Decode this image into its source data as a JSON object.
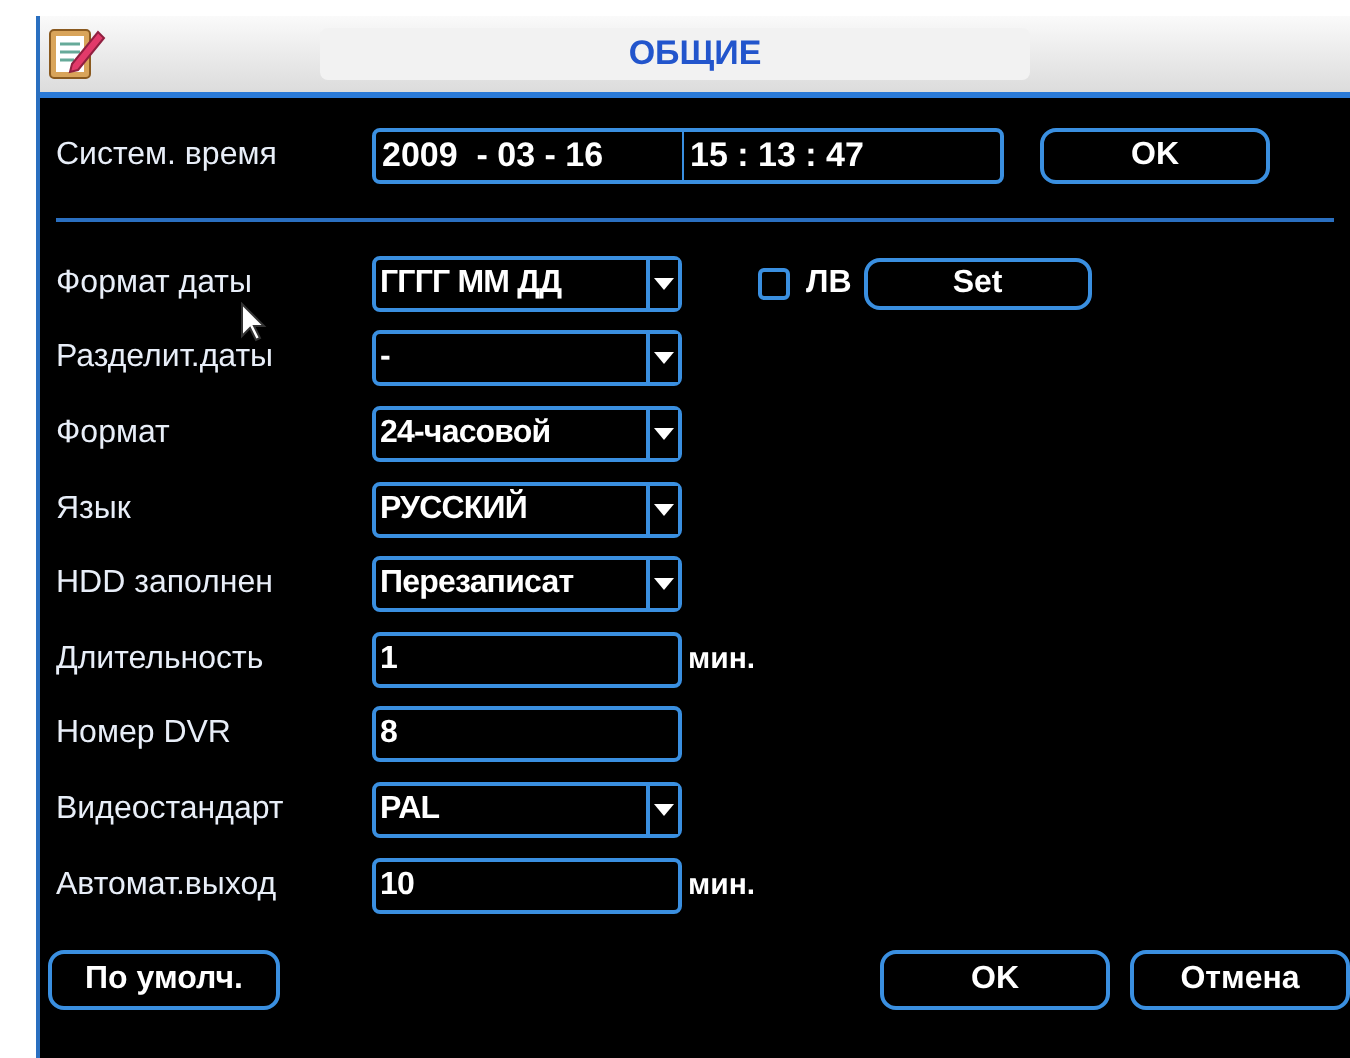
{
  "window": {
    "title": "ОБЩИЕ"
  },
  "system_time": {
    "label": "Систем. время",
    "date": "2009  - 03 - 16",
    "time": "15 : 13 : 47",
    "button": "OK"
  },
  "fields": [
    {
      "label": "Формат даты",
      "kind": "select",
      "value": "ГГГГ ММ ДД",
      "extra": {
        "checkbox_label": "ЛВ",
        "checked": false,
        "button": "Set"
      }
    },
    {
      "label": "Разделит.даты",
      "kind": "select",
      "value": "-"
    },
    {
      "label": "Формат",
      "kind": "select",
      "value": "24-часовой"
    },
    {
      "label": "Язык",
      "kind": "select",
      "value": "РУССКИЙ"
    },
    {
      "label": "HDD заполнен",
      "kind": "select",
      "value": "Перезаписат"
    },
    {
      "label": "Длительность",
      "kind": "input",
      "value": "1",
      "unit": "мин."
    },
    {
      "label": "Номер DVR",
      "kind": "input",
      "value": "8"
    },
    {
      "label": "Видеостандарт",
      "kind": "select",
      "value": "PAL"
    },
    {
      "label": "Автомат.выход",
      "kind": "input",
      "value": "10",
      "unit": "мин."
    }
  ],
  "buttons": {
    "default": "По умолч.",
    "ok": "OK",
    "cancel": "Отмена"
  }
}
